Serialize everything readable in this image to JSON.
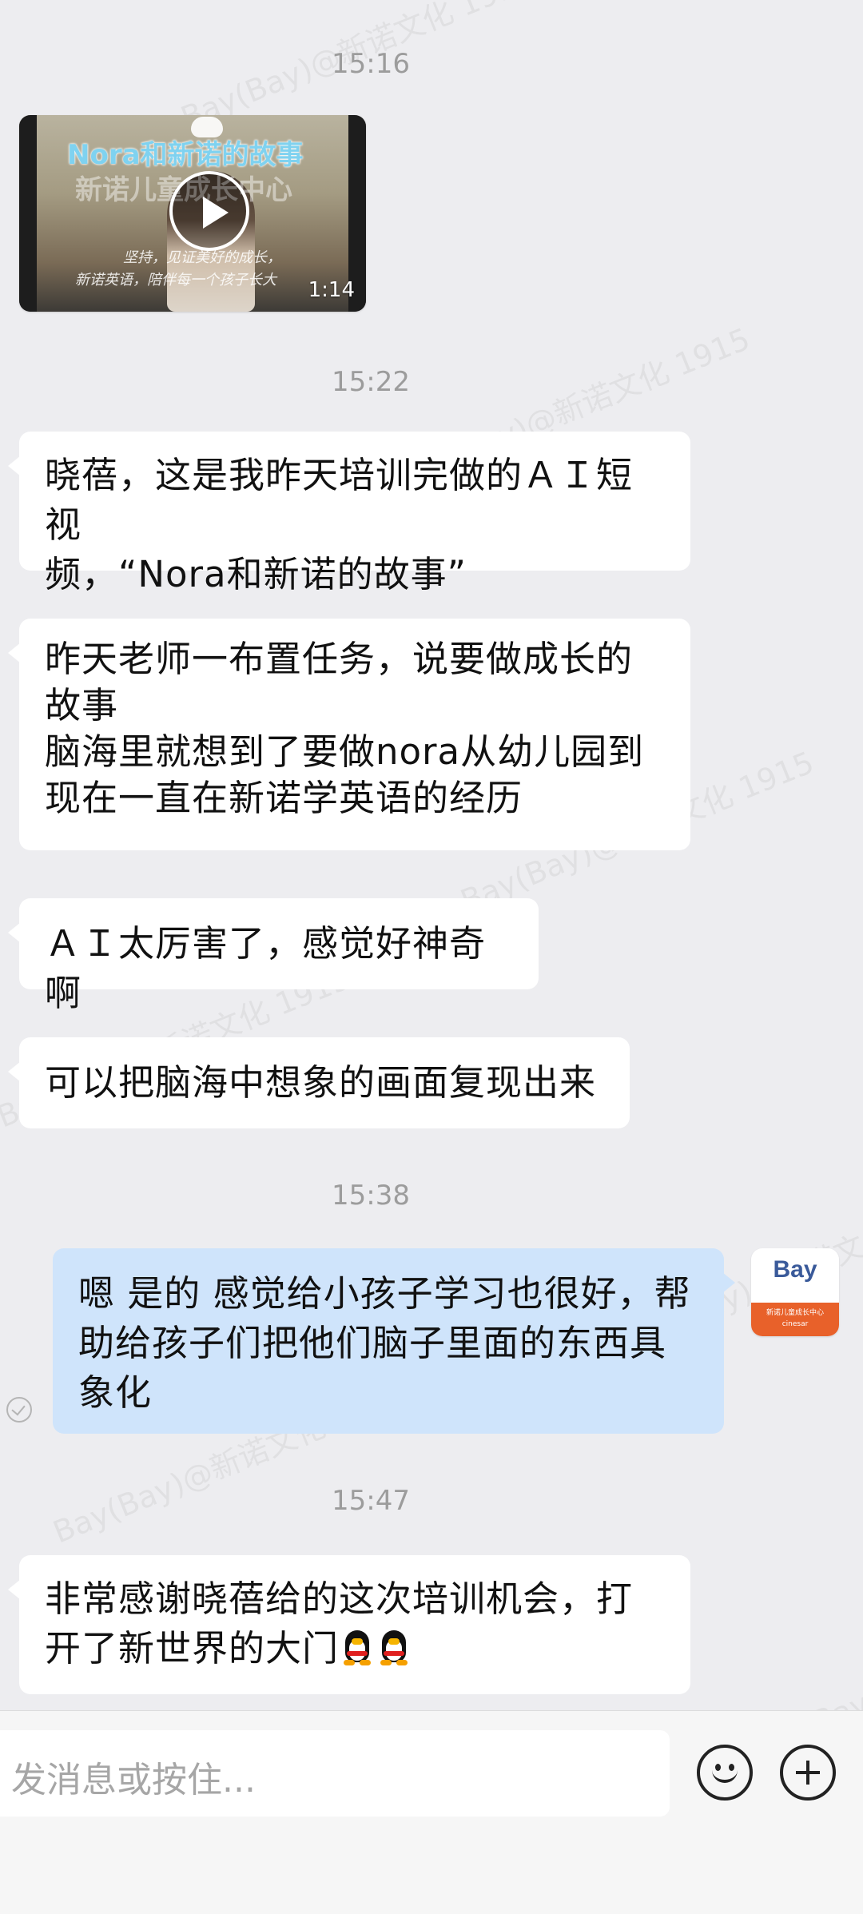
{
  "watermark": "Bay(Bay)@新诺文化 1915",
  "messages": [
    {
      "time": "15:16"
    },
    {
      "video": {
        "title": "Nora和新诺的故事",
        "subtitle": "新诺儿童成长中心",
        "caption_line1": "坚持，见证美好的成长，",
        "caption_line2": "新诺英语，陪伴每一个孩子长大",
        "duration": "1:14"
      }
    },
    {
      "time": "15:22"
    },
    {
      "text_lines": [
        "晓蓓，这是我昨天培训完做的ＡＩ短视",
        "频，“Nora和新诺的故事”"
      ]
    },
    {
      "text_lines": [
        "昨天老师一布置任务，说要做成长的",
        "故事",
        "脑海里就想到了要做nora从幼儿园到",
        "现在一直在新诺学英语的经历"
      ]
    },
    {
      "text_lines": [
        "ＡＩ太厉害了，感觉好神奇啊"
      ]
    },
    {
      "text_lines": [
        "可以把脑海中想象的画面复现出来"
      ]
    },
    {
      "time": "15:38"
    },
    {
      "text_lines": [
        "嗯 是的 感觉给小孩子学习也很好，帮",
        "助给孩子们把他们脑子里面的东西具",
        "象化"
      ]
    },
    {
      "time": "15:47"
    },
    {
      "text_lines": [
        "非常感谢晓蓓给的这次培训机会，打",
        "开了新世界的大门"
      ]
    }
  ],
  "avatar": {
    "brand": "Bay",
    "tagline": "新诺儿童成长中心",
    "sub": "cinesar"
  },
  "input": {
    "placeholder": "发消息或按住..."
  },
  "icons": {
    "emoji_button": "smile-icon",
    "more_button": "plus-icon",
    "message_emoji": "penguin-icon"
  }
}
